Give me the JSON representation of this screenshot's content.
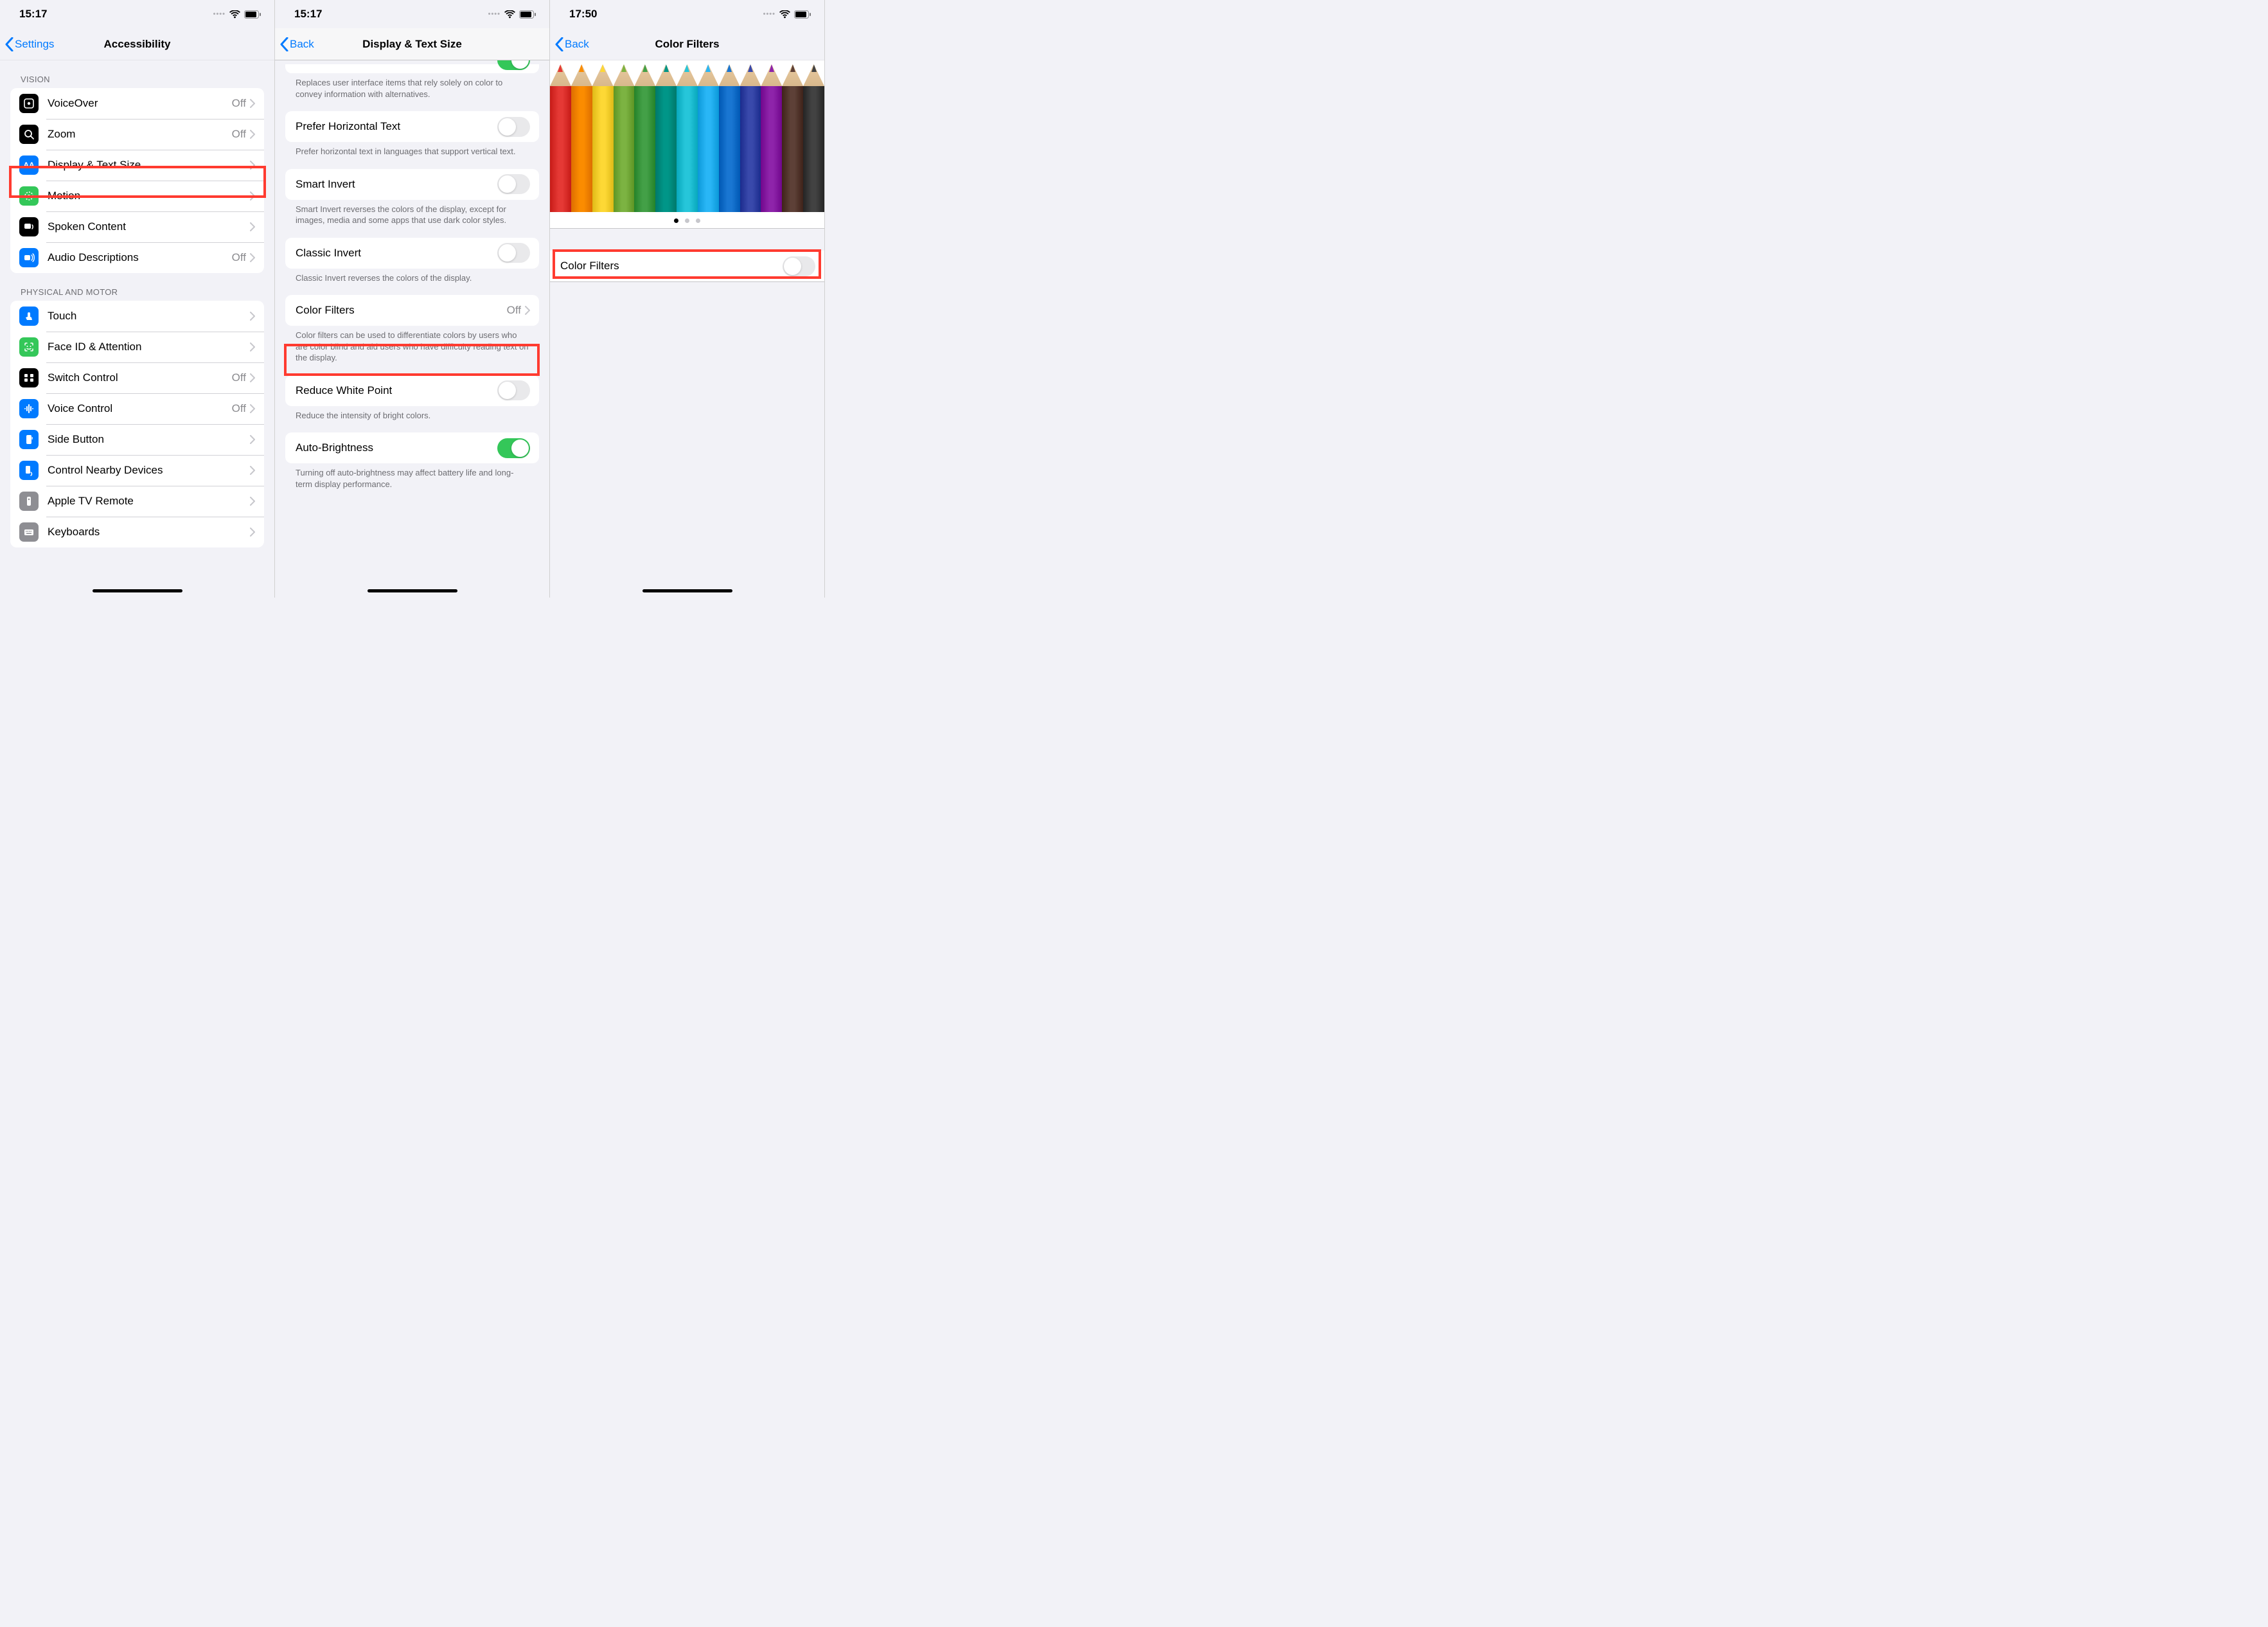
{
  "screen1": {
    "status": {
      "time": "15:17"
    },
    "nav": {
      "back": "Settings",
      "title": "Accessibility"
    },
    "section_vision": "VISION",
    "vision": [
      {
        "label": "VoiceOver",
        "value": "Off"
      },
      {
        "label": "Zoom",
        "value": "Off"
      },
      {
        "label": "Display & Text Size",
        "value": ""
      },
      {
        "label": "Motion",
        "value": ""
      },
      {
        "label": "Spoken Content",
        "value": ""
      },
      {
        "label": "Audio Descriptions",
        "value": "Off"
      }
    ],
    "section_physical": "PHYSICAL AND MOTOR",
    "physical": [
      {
        "label": "Touch",
        "value": ""
      },
      {
        "label": "Face ID & Attention",
        "value": ""
      },
      {
        "label": "Switch Control",
        "value": "Off"
      },
      {
        "label": "Voice Control",
        "value": "Off"
      },
      {
        "label": "Side Button",
        "value": ""
      },
      {
        "label": "Control Nearby Devices",
        "value": ""
      },
      {
        "label": "Apple TV Remote",
        "value": ""
      },
      {
        "label": "Keyboards",
        "value": ""
      }
    ]
  },
  "screen2": {
    "status": {
      "time": "15:17"
    },
    "nav": {
      "back": "Back",
      "title": "Display & Text Size"
    },
    "footer_diff": "Replaces user interface items that rely solely on color to convey information with alternatives.",
    "rows": {
      "prefer_horizontal": "Prefer Horizontal Text",
      "footer_horizontal": "Prefer horizontal text in languages that support vertical text.",
      "smart_invert": "Smart Invert",
      "footer_smart": "Smart Invert reverses the colors of the display, except for images, media and some apps that use dark color styles.",
      "classic_invert": "Classic Invert",
      "footer_classic": "Classic Invert reverses the colors of the display.",
      "color_filters": "Color Filters",
      "color_filters_value": "Off",
      "footer_filters": "Color filters can be used to differentiate colors by users who are color blind and aid users who have difficulty reading text on the display.",
      "reduce_white": "Reduce White Point",
      "footer_white": "Reduce the intensity of bright colors.",
      "auto_brightness": "Auto-Brightness",
      "footer_auto": "Turning off auto-brightness may affect battery life and long-term display performance."
    }
  },
  "screen3": {
    "status": {
      "time": "17:50"
    },
    "nav": {
      "back": "Back",
      "title": "Color Filters"
    },
    "pencil_colors": [
      "#e53935",
      "#fb8c00",
      "#fdd835",
      "#7cb342",
      "#43a047",
      "#009688",
      "#26c6da",
      "#29b6f6",
      "#1976d2",
      "#3949ab",
      "#8e24aa",
      "#5d4037",
      "#424242"
    ],
    "row_label": "Color Filters"
  }
}
